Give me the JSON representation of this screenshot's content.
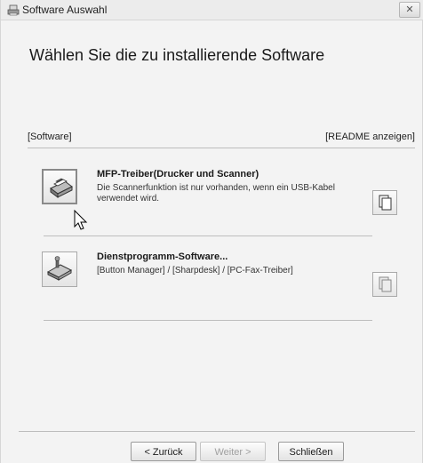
{
  "window": {
    "title": "Software Auswahl",
    "close_label": "✕"
  },
  "heading": "Wählen Sie die zu installierende Software",
  "section": {
    "left_label": "[Software]",
    "right_label": "[README anzeigen]"
  },
  "software": [
    {
      "title": "MFP-Treiber(Drucker und Scanner)",
      "description": "Die Scannerfunktion ist nur vorhanden, wenn ein USB-Kabel verwendet wird.",
      "icon": "printer-scanner-icon",
      "readme_icon": "readme-document-icon"
    },
    {
      "title": "Dienstprogramm-Software...",
      "description": "[Button Manager] / [Sharpdesk] / [PC-Fax-Treiber]",
      "icon": "utility-software-icon",
      "readme_icon": "readme-document-icon"
    }
  ],
  "buttons": {
    "back": "< Zurück",
    "next": "Weiter >",
    "close": "Schließen"
  }
}
